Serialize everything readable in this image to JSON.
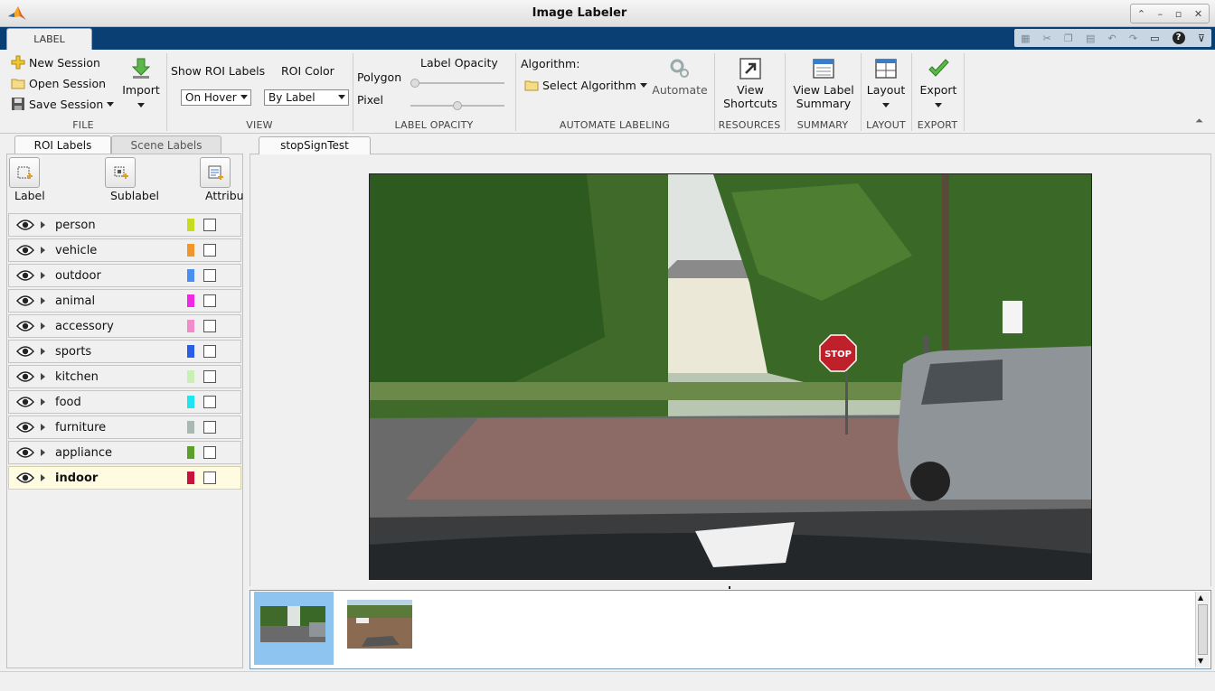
{
  "window": {
    "title": "Image Labeler"
  },
  "tabs": {
    "label": "LABEL"
  },
  "ribbon": {
    "file": {
      "new_session": "New Session",
      "open_session": "Open Session",
      "save_session": "Save Session",
      "import": "Import",
      "title": "FILE"
    },
    "view": {
      "show_roi_labels": "Show ROI Labels",
      "roi_labels_value": "On Hover",
      "roi_color": "ROI Color",
      "roi_color_value": "By Label",
      "title": "VIEW"
    },
    "label_opacity": {
      "heading": "Label Opacity",
      "polygon": "Polygon",
      "pixel": "Pixel",
      "polygon_level": 0.0,
      "pixel_level": 0.5,
      "title": "LABEL OPACITY"
    },
    "automate": {
      "algorithm": "Algorithm:",
      "select_algorithm": "Select Algorithm",
      "automate": "Automate",
      "title": "AUTOMATE LABELING"
    },
    "resources": {
      "line1": "View",
      "line2": "Shortcuts",
      "title": "RESOURCES"
    },
    "summary": {
      "line1": "View Label",
      "line2": "Summary",
      "title": "SUMMARY"
    },
    "layout": {
      "label": "Layout",
      "title": "LAYOUT"
    },
    "export": {
      "label": "Export",
      "title": "EXPORT"
    }
  },
  "left_panel": {
    "tabs": [
      "ROI Labels",
      "Scene Labels"
    ],
    "buttons": {
      "label": "Label",
      "sublabel": "Sublabel",
      "attribute": "Attribu"
    },
    "labels": [
      {
        "name": "person",
        "color": "#c8dc1e"
      },
      {
        "name": "vehicle",
        "color": "#f0962a"
      },
      {
        "name": "outdoor",
        "color": "#4a8ef0"
      },
      {
        "name": "animal",
        "color": "#f028e6"
      },
      {
        "name": "accessory",
        "color": "#f08cc8"
      },
      {
        "name": "sports",
        "color": "#2a5ee6"
      },
      {
        "name": "kitchen",
        "color": "#c8f0b4"
      },
      {
        "name": "food",
        "color": "#1ee6f0"
      },
      {
        "name": "furniture",
        "color": "#aab8b4"
      },
      {
        "name": "appliance",
        "color": "#5aa02a"
      },
      {
        "name": "indoor",
        "color": "#c8143c"
      }
    ],
    "selected": "indoor"
  },
  "document": {
    "tab": "stopSignTest",
    "stop_sign": "STOP"
  }
}
